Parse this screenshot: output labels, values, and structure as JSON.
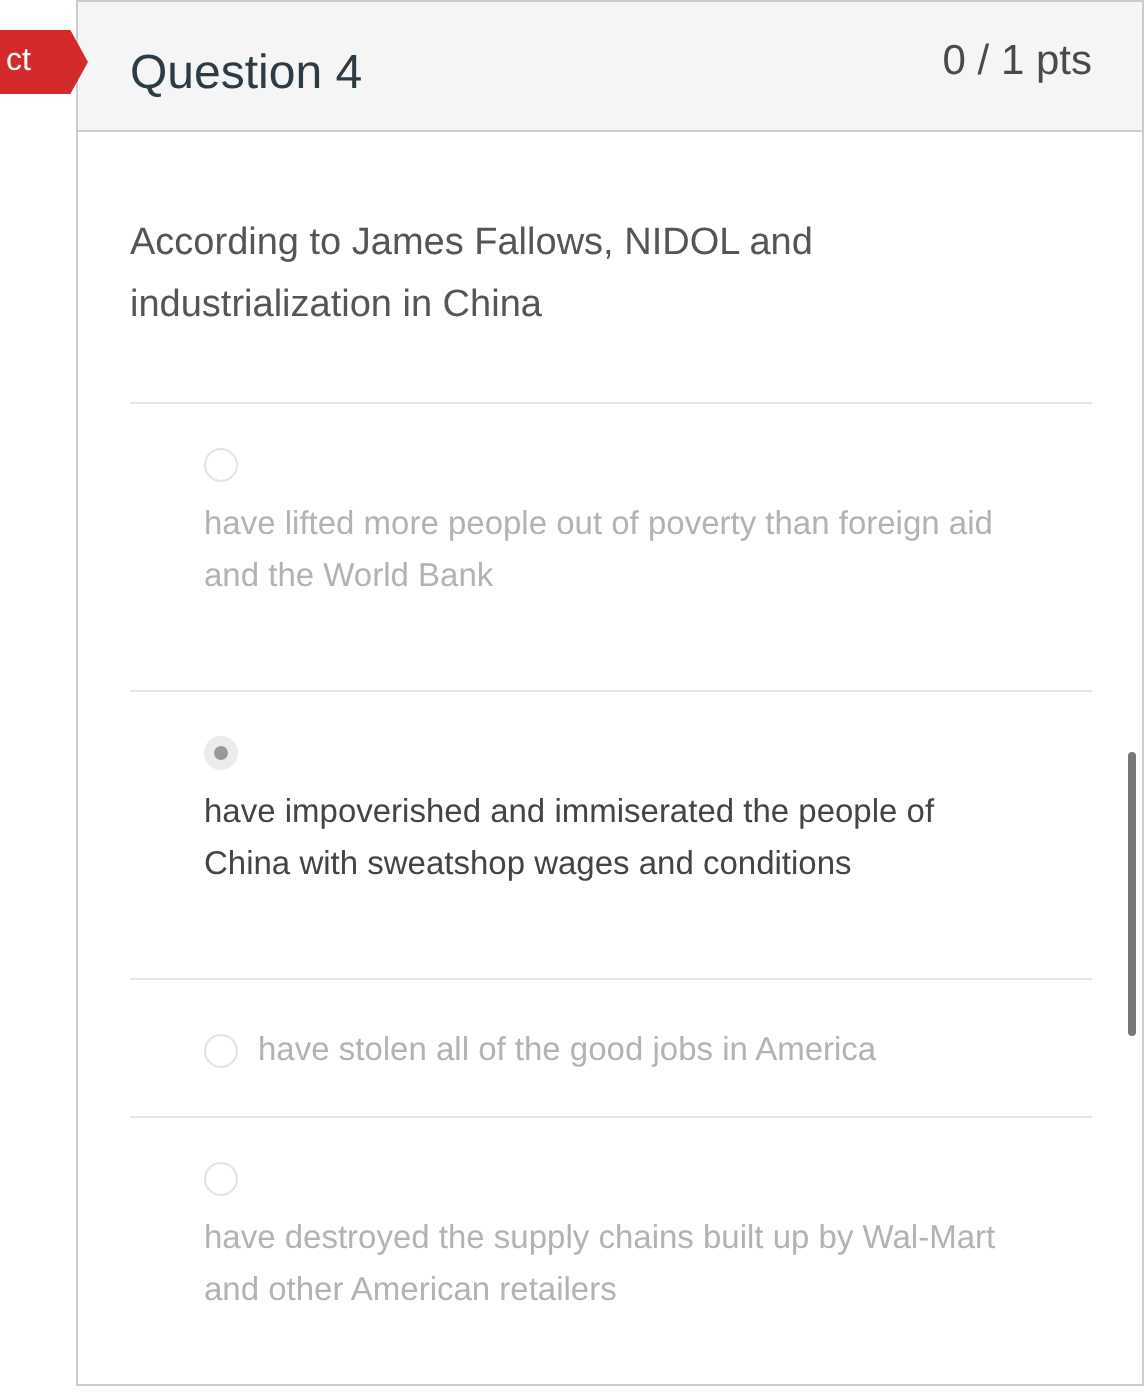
{
  "flag": {
    "label": "ct"
  },
  "question": {
    "title": "Question 4",
    "points": "0 / 1 pts",
    "text": "According to James Fallows, NIDOL and industrialization in China"
  },
  "answers": [
    {
      "kind": "stacked",
      "text": "have lifted more people out of poverty than foreign aid and the World Bank",
      "selected": false
    },
    {
      "kind": "stacked",
      "text": "have impoverished and immiserated the people of China with sweatshop wages and conditions",
      "selected": true
    },
    {
      "kind": "inline",
      "text": "have stolen all of the good jobs in America",
      "selected": false
    },
    {
      "kind": "stacked",
      "text": "have destroyed the supply chains built up by Wal-Mart and other American retailers",
      "selected": false
    }
  ]
}
